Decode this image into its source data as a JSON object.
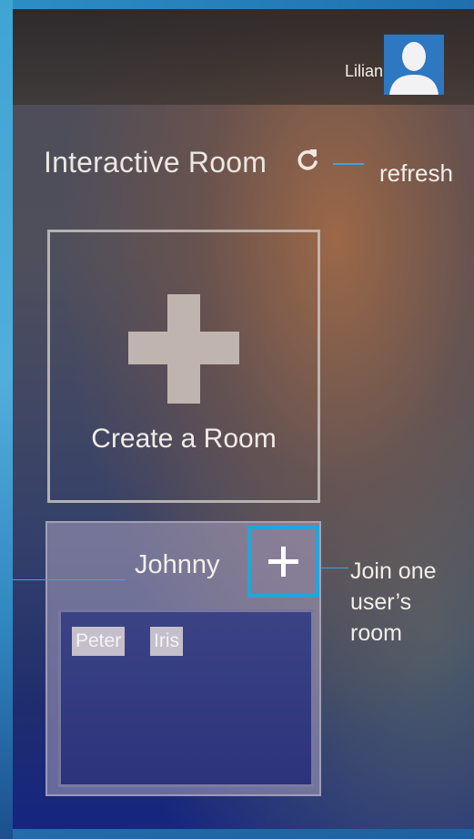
{
  "header": {
    "username": "Lilian",
    "avatar_icon": "user-silhouette-icon"
  },
  "page": {
    "title": "Interactive Room",
    "refresh_icon": "refresh-icon",
    "refresh_annotation": "refresh"
  },
  "create_room": {
    "label": "Create a Room",
    "icon": "plus-icon"
  },
  "rooms": [
    {
      "owner": "Johnny",
      "join_icon": "plus-icon",
      "members": [
        "Peter",
        "Iris"
      ]
    }
  ],
  "annotations": {
    "join_note": "Join one user’s room"
  },
  "colors": {
    "accent_blue": "#27a3d8",
    "card_border": "#c8c3be",
    "member_tag_bg": "#c5bfcb"
  }
}
